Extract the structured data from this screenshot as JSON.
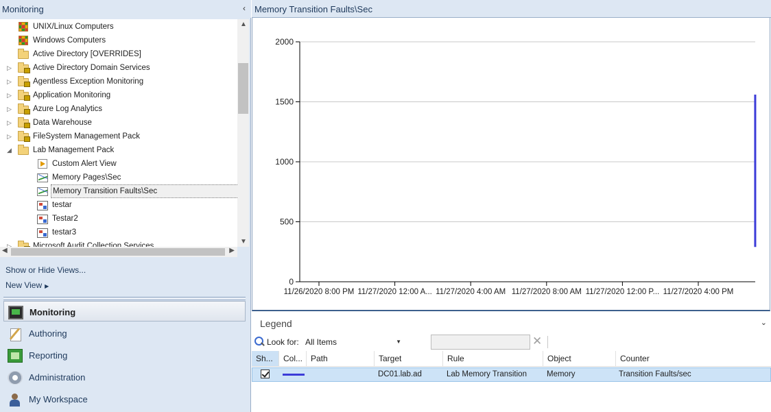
{
  "left_pane": {
    "title": "Monitoring",
    "collapse_glyph": "‹",
    "tree": [
      {
        "label": "UNIX/Linux Computers",
        "icon": "state-grid-icon",
        "expander": ""
      },
      {
        "label": "Windows Computers",
        "icon": "state-grid-icon",
        "expander": ""
      },
      {
        "label": "Active Directory [OVERRIDES]",
        "icon": "folder-icon",
        "expander": ""
      },
      {
        "label": "Active Directory Domain Services",
        "icon": "locked-folder-icon",
        "expander": "▷"
      },
      {
        "label": "Agentless Exception Monitoring",
        "icon": "locked-folder-icon",
        "expander": "▷"
      },
      {
        "label": "Application Monitoring",
        "icon": "locked-folder-icon",
        "expander": "▷"
      },
      {
        "label": "Azure Log Analytics",
        "icon": "locked-folder-icon",
        "expander": "▷"
      },
      {
        "label": "Data Warehouse",
        "icon": "locked-folder-icon",
        "expander": "▷"
      },
      {
        "label": "FileSystem Management Pack",
        "icon": "locked-folder-icon",
        "expander": "▷"
      },
      {
        "label": "Lab Management Pack",
        "icon": "open-folder-icon",
        "expander": "◢"
      },
      {
        "label": "Custom Alert View",
        "icon": "alert-view-icon",
        "expander": ""
      },
      {
        "label": "Memory Pages\\Sec",
        "icon": "performance-view-icon",
        "expander": ""
      },
      {
        "label": "Memory Transition Faults\\Sec",
        "icon": "performance-view-icon",
        "expander": "",
        "selected": true
      },
      {
        "label": "testar",
        "icon": "dashboard-view-icon",
        "expander": ""
      },
      {
        "label": "Testar2",
        "icon": "dashboard-view-icon",
        "expander": ""
      },
      {
        "label": "testar3",
        "icon": "dashboard-view-icon",
        "expander": ""
      },
      {
        "label": "Microsoft Audit Collection Services",
        "icon": "locked-folder-icon",
        "expander": "▷"
      }
    ],
    "links": {
      "show_hide": "Show or Hide Views...",
      "new_view": "New View",
      "new_view_arrow": "▶"
    },
    "workspaces": [
      {
        "label": "Monitoring",
        "icon": "monitoring-icon",
        "active": true
      },
      {
        "label": "Authoring",
        "icon": "authoring-icon"
      },
      {
        "label": "Reporting",
        "icon": "reporting-icon"
      },
      {
        "label": "Administration",
        "icon": "administration-icon"
      },
      {
        "label": "My Workspace",
        "icon": "my-workspace-icon"
      }
    ]
  },
  "chart_panel": {
    "title": "Memory Transition Faults\\Sec"
  },
  "chart_data": {
    "type": "line",
    "ylim": [
      0,
      2000
    ],
    "yticks": [
      0,
      500,
      1000,
      1500,
      2000
    ],
    "xticks": [
      "11/26/2020 8:00 PM",
      "11/27/2020  12:00 A...",
      "11/27/2020 4:00 AM",
      "11/27/2020 8:00 AM",
      "11/27/2020  12:00 P...",
      "11/27/2020 4:00 PM"
    ],
    "series": [
      {
        "color": "#3c3cd8",
        "x_position": 5.75,
        "values": [
          290,
          1560
        ]
      }
    ],
    "grid": true,
    "colors": {
      "series": "#3c3cd8",
      "grid": "#c8c8c8",
      "axis": "#000000"
    }
  },
  "legend": {
    "title": "Legend",
    "chevron": "⌄",
    "look_for_label": "Look for:",
    "look_for_value": "All Items",
    "dropdown_glyph": "▼",
    "clear_glyph": "✕",
    "columns": [
      "Sh...",
      "Col...",
      "Path",
      "Target",
      "Rule",
      "Object",
      "Counter"
    ],
    "rows": [
      {
        "shown": true,
        "color": "#3c3cd8",
        "path": "",
        "target": "DC01.lab.ad",
        "rule": "Lab Memory Transition",
        "object": "Memory",
        "counter": "Transition Faults/sec"
      }
    ]
  }
}
